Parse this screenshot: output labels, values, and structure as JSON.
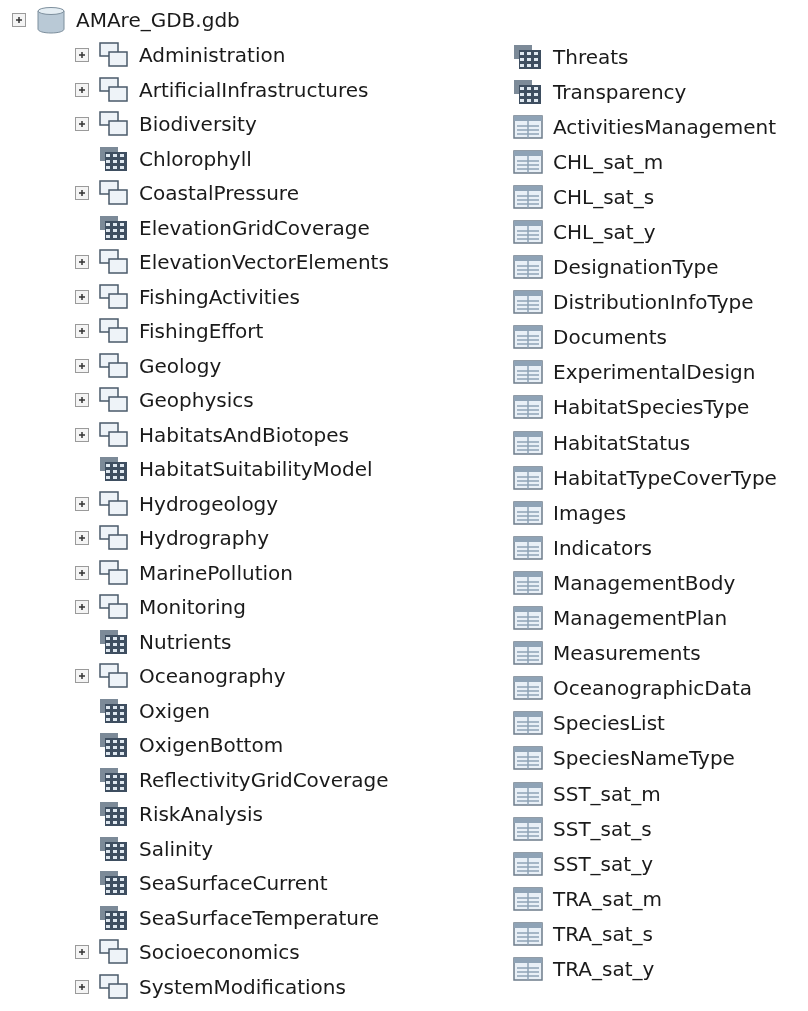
{
  "root": {
    "label": "AMAre_GDB.gdb",
    "kind": "geodatabase",
    "children": [
      {
        "label": "Administration",
        "kind": "feature_dataset"
      },
      {
        "label": "ArtificialInfrastructures",
        "kind": "feature_dataset"
      },
      {
        "label": "Biodiversity",
        "kind": "feature_dataset"
      },
      {
        "label": "Chlorophyll",
        "kind": "raster"
      },
      {
        "label": "CoastalPressure",
        "kind": "feature_dataset"
      },
      {
        "label": "ElevationGridCoverage",
        "kind": "raster"
      },
      {
        "label": "ElevationVectorElements",
        "kind": "feature_dataset"
      },
      {
        "label": "FishingActivities",
        "kind": "feature_dataset"
      },
      {
        "label": "FishingEffort",
        "kind": "feature_dataset"
      },
      {
        "label": "Geology",
        "kind": "feature_dataset"
      },
      {
        "label": "Geophysics",
        "kind": "feature_dataset"
      },
      {
        "label": "HabitatsAndBiotopes",
        "kind": "feature_dataset"
      },
      {
        "label": "HabitatSuitabilityModel",
        "kind": "raster"
      },
      {
        "label": "Hydrogeology",
        "kind": "feature_dataset"
      },
      {
        "label": "Hydrography",
        "kind": "feature_dataset"
      },
      {
        "label": "MarinePollution",
        "kind": "feature_dataset"
      },
      {
        "label": "Monitoring",
        "kind": "feature_dataset"
      },
      {
        "label": "Nutrients",
        "kind": "raster"
      },
      {
        "label": "Oceanography",
        "kind": "feature_dataset"
      },
      {
        "label": "Oxigen",
        "kind": "raster"
      },
      {
        "label": "OxigenBottom",
        "kind": "raster"
      },
      {
        "label": "ReflectivityGridCoverage",
        "kind": "raster"
      },
      {
        "label": "RiskAnalysis",
        "kind": "raster"
      },
      {
        "label": "Salinity",
        "kind": "raster"
      },
      {
        "label": "SeaSurfaceCurrent",
        "kind": "raster"
      },
      {
        "label": "SeaSurfaceTemperature",
        "kind": "raster"
      },
      {
        "label": "Socioeconomics",
        "kind": "feature_dataset"
      },
      {
        "label": "SystemModifications",
        "kind": "feature_dataset"
      },
      {
        "label": "Threats",
        "kind": "raster"
      },
      {
        "label": "Transparency",
        "kind": "raster"
      },
      {
        "label": "ActivitiesManagement",
        "kind": "table"
      },
      {
        "label": "CHL_sat_m",
        "kind": "table"
      },
      {
        "label": "CHL_sat_s",
        "kind": "table"
      },
      {
        "label": "CHL_sat_y",
        "kind": "table"
      },
      {
        "label": "DesignationType",
        "kind": "table"
      },
      {
        "label": "DistributionInfoType",
        "kind": "table"
      },
      {
        "label": "Documents",
        "kind": "table"
      },
      {
        "label": "ExperimentalDesign",
        "kind": "table"
      },
      {
        "label": "HabitatSpeciesType",
        "kind": "table"
      },
      {
        "label": "HabitatStatus",
        "kind": "table"
      },
      {
        "label": "HabitatTypeCoverType",
        "kind": "table"
      },
      {
        "label": "Images",
        "kind": "table"
      },
      {
        "label": "Indicators",
        "kind": "table"
      },
      {
        "label": "ManagementBody",
        "kind": "table"
      },
      {
        "label": "ManagementPlan",
        "kind": "table"
      },
      {
        "label": "Measurements",
        "kind": "table"
      },
      {
        "label": "OceanographicData",
        "kind": "table"
      },
      {
        "label": "SpeciesList",
        "kind": "table"
      },
      {
        "label": "SpeciesNameType",
        "kind": "table"
      },
      {
        "label": "SST_sat_m",
        "kind": "table"
      },
      {
        "label": "SST_sat_s",
        "kind": "table"
      },
      {
        "label": "SST_sat_y",
        "kind": "table"
      },
      {
        "label": "TRA_sat_m",
        "kind": "table"
      },
      {
        "label": "TRA_sat_s",
        "kind": "table"
      },
      {
        "label": "TRA_sat_y",
        "kind": "table"
      }
    ]
  }
}
